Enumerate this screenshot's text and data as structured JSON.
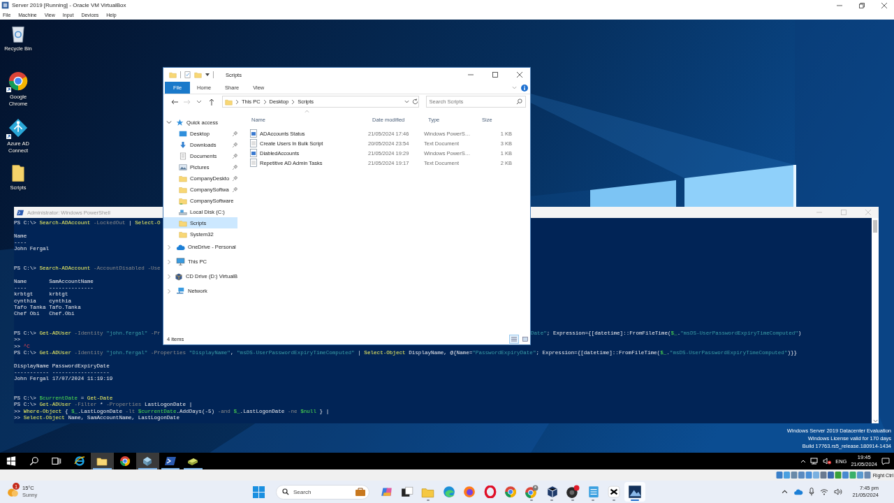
{
  "virtualbox": {
    "title": "Server 2019 [Running] - Oracle VM VirtualBox",
    "menu": [
      "File",
      "Machine",
      "View",
      "Input",
      "Devices",
      "Help"
    ],
    "host_key": "Right Ctrl"
  },
  "desktop_icons": [
    {
      "kind": "recycle-bin",
      "label": "Recycle Bin",
      "shortcut": false
    },
    {
      "kind": "chrome",
      "label": "Google Chrome",
      "shortcut": true
    },
    {
      "kind": "azure",
      "label": "Azure AD Connect",
      "shortcut": true
    },
    {
      "kind": "folder",
      "label": "Scripts",
      "shortcut": false
    }
  ],
  "explorer": {
    "title": "Scripts",
    "ribbon_tabs": [
      {
        "label": "File",
        "selected": true
      },
      {
        "label": "Home",
        "selected": false
      },
      {
        "label": "Share",
        "selected": false
      },
      {
        "label": "View",
        "selected": false
      }
    ],
    "forward_disabled": true,
    "path": [
      "This PC",
      "Desktop",
      "Scripts"
    ],
    "search": {
      "placeholder": "Search Scripts"
    },
    "nav": [
      {
        "kind": "star",
        "label": "Quick access",
        "expanded": true,
        "selected": false,
        "children": [
          {
            "kind": "desktop",
            "label": "Desktop",
            "pinned": true,
            "selected": false
          },
          {
            "kind": "download",
            "label": "Downloads",
            "pinned": true,
            "selected": false
          },
          {
            "kind": "documents",
            "label": "Documents",
            "pinned": true,
            "selected": false
          },
          {
            "kind": "pictures",
            "label": "Pictures",
            "pinned": true,
            "selected": false
          },
          {
            "kind": "folder",
            "label": "CompanyDeskto",
            "pinned": true,
            "selected": false
          },
          {
            "kind": "folder",
            "label": "CompanySoftwa",
            "pinned": true,
            "selected": false
          },
          {
            "kind": "shared-folder",
            "label": "CompanySoftware",
            "pinned": false,
            "selected": false
          },
          {
            "kind": "disk",
            "label": "Local Disk (C:)",
            "pinned": false,
            "selected": false
          },
          {
            "kind": "folder",
            "label": "Scripts",
            "pinned": false,
            "selected": true
          },
          {
            "kind": "folder",
            "label": "System32",
            "pinned": false,
            "selected": false
          }
        ]
      },
      {
        "kind": "cloud",
        "label": "OneDrive - Personal",
        "expanded": false,
        "selected": false
      },
      {
        "kind": "pc",
        "label": "This PC",
        "expanded": false,
        "selected": false
      },
      {
        "kind": "cd",
        "label": "CD Drive (D:) VirtualB",
        "expanded": false,
        "selected": false
      },
      {
        "kind": "network",
        "label": "Network",
        "expanded": false,
        "selected": false
      }
    ],
    "columns": [
      "Name",
      "Date modified",
      "Type",
      "Size"
    ],
    "files": [
      {
        "kind": "script",
        "name": "ADAccounts Status",
        "date": "21/05/2024 17:46",
        "type": "Windows PowerS…",
        "size": "1 KB"
      },
      {
        "kind": "text",
        "name": "Create Users In Bulk Script",
        "date": "20/05/2024 23:54",
        "type": "Text Document",
        "size": "3 KB"
      },
      {
        "kind": "script",
        "name": "DiabledAccounts",
        "date": "21/05/2024 19:29",
        "type": "Windows PowerS…",
        "size": "1 KB"
      },
      {
        "kind": "text",
        "name": "Repetitive AD Admin Tasks",
        "date": "21/05/2024 19:17",
        "type": "Text Document",
        "size": "2 KB"
      }
    ],
    "status": "4 items",
    "view_modes": [
      {
        "kind": "details",
        "selected": true
      },
      {
        "kind": "large-icons",
        "selected": false
      }
    ]
  },
  "powershell": {
    "title": "Administrator: Windows PowerShell",
    "lines": [
      {
        "kind": "text",
        "segments": [
          {
            "kind": "plain",
            "text": "PS C:\\> "
          },
          {
            "kind": "command",
            "text": "Search-ADAccount"
          },
          {
            "kind": "parameter",
            "text": " -LockedOut"
          },
          {
            "kind": "plain",
            "text": " | "
          },
          {
            "kind": "command",
            "text": "Select-O"
          }
        ]
      },
      {
        "kind": "blank"
      },
      {
        "kind": "text",
        "segments": [
          {
            "kind": "plain",
            "text": "Name"
          }
        ]
      },
      {
        "kind": "text",
        "segments": [
          {
            "kind": "plain",
            "text": "----"
          }
        ]
      },
      {
        "kind": "text",
        "segments": [
          {
            "kind": "plain",
            "text": "John Fergal"
          }
        ]
      },
      {
        "kind": "blank"
      },
      {
        "kind": "blank"
      },
      {
        "kind": "text",
        "segments": [
          {
            "kind": "plain",
            "text": "PS C:\\> "
          },
          {
            "kind": "command",
            "text": "Search-ADAccount"
          },
          {
            "kind": "parameter",
            "text": " -AccountDisabled -Use"
          }
        ]
      },
      {
        "kind": "blank"
      },
      {
        "kind": "text",
        "segments": [
          {
            "kind": "plain",
            "text": "Name       SamAccountName"
          }
        ]
      },
      {
        "kind": "text",
        "segments": [
          {
            "kind": "plain",
            "text": "----       --------------"
          }
        ]
      },
      {
        "kind": "text",
        "segments": [
          {
            "kind": "plain",
            "text": "krbtgt     krbtgt"
          }
        ]
      },
      {
        "kind": "text",
        "segments": [
          {
            "kind": "plain",
            "text": "cynthia    cynthia"
          }
        ]
      },
      {
        "kind": "text",
        "segments": [
          {
            "kind": "plain",
            "text": "Tafo Tanka Tafo.Tanka"
          }
        ]
      },
      {
        "kind": "text",
        "segments": [
          {
            "kind": "plain",
            "text": "Chef Obi   Chef.Obi"
          }
        ]
      },
      {
        "kind": "blank"
      },
      {
        "kind": "blank"
      },
      {
        "kind": "split",
        "segments": [
          {
            "kind": "plain",
            "text": "PS C:\\> "
          },
          {
            "kind": "command",
            "text": "Get-ADUser"
          },
          {
            "kind": "parameter",
            "text": " -Identity "
          },
          {
            "kind": "string",
            "text": "\"john.fergal\""
          },
          {
            "kind": "parameter",
            "text": " -Pr"
          }
        ],
        "after_gap": [
          {
            "kind": "string",
            "text": "Date\""
          },
          {
            "kind": "plain",
            "text": "; Expression={[datetime]::FromFileTime("
          },
          {
            "kind": "variable",
            "text": "$_"
          },
          {
            "kind": "plain",
            "text": "."
          },
          {
            "kind": "string",
            "text": "\"msDS-UserPasswordExpiryTimeComputed\""
          },
          {
            "kind": "plain",
            "text": ")"
          }
        ]
      },
      {
        "kind": "text",
        "segments": [
          {
            "kind": "plain",
            "text": ">>"
          }
        ]
      },
      {
        "kind": "text",
        "segments": [
          {
            "kind": "plain",
            "text": ">> "
          },
          {
            "kind": "error",
            "text": "^C"
          }
        ]
      },
      {
        "kind": "text",
        "segments": [
          {
            "kind": "plain",
            "text": "PS C:\\> "
          },
          {
            "kind": "command",
            "text": "Get-ADUser"
          },
          {
            "kind": "parameter",
            "text": " -Identity "
          },
          {
            "kind": "string",
            "text": "\"john.fergal\""
          },
          {
            "kind": "parameter",
            "text": " -Properties "
          },
          {
            "kind": "string",
            "text": "\"DisplayName\""
          },
          {
            "kind": "plain",
            "text": ", "
          },
          {
            "kind": "string",
            "text": "\"msDS-UserPasswordExpiryTimeComputed\""
          },
          {
            "kind": "plain",
            "text": " | "
          },
          {
            "kind": "command",
            "text": "Select-Object"
          },
          {
            "kind": "plain",
            "text": " DisplayName, @{Name="
          },
          {
            "kind": "string",
            "text": "\"PasswordExpiryDate\""
          },
          {
            "kind": "plain",
            "text": "; Expression={[datetime]::FromFileTime("
          },
          {
            "kind": "variable",
            "text": "$_"
          },
          {
            "kind": "plain",
            "text": "."
          },
          {
            "kind": "string",
            "text": "\"msDS-UserPasswordExpiryTimeComputed\""
          },
          {
            "kind": "plain",
            "text": ")}}"
          }
        ]
      },
      {
        "kind": "blank"
      },
      {
        "kind": "text",
        "segments": [
          {
            "kind": "plain",
            "text": "DisplayName PasswordExpiryDate"
          }
        ]
      },
      {
        "kind": "text",
        "segments": [
          {
            "kind": "plain",
            "text": "----------- ------------------"
          }
        ]
      },
      {
        "kind": "text",
        "segments": [
          {
            "kind": "plain",
            "text": "John Fergal 17/07/2024 11:19:19"
          }
        ]
      },
      {
        "kind": "blank"
      },
      {
        "kind": "blank"
      },
      {
        "kind": "text",
        "segments": [
          {
            "kind": "plain",
            "text": "PS C:\\> "
          },
          {
            "kind": "variable",
            "text": "$currentDate"
          },
          {
            "kind": "plain",
            "text": " = "
          },
          {
            "kind": "command",
            "text": "Get-Date"
          }
        ]
      },
      {
        "kind": "text",
        "segments": [
          {
            "kind": "plain",
            "text": "PS C:\\> "
          },
          {
            "kind": "command",
            "text": "Get-ADUser"
          },
          {
            "kind": "parameter",
            "text": " -Filter "
          },
          {
            "kind": "plain",
            "text": "*"
          },
          {
            "kind": "parameter",
            "text": " -Properties "
          },
          {
            "kind": "plain",
            "text": "LastLogonDate |"
          }
        ]
      },
      {
        "kind": "text",
        "segments": [
          {
            "kind": "plain",
            "text": ">> "
          },
          {
            "kind": "command",
            "text": "Where-Object"
          },
          {
            "kind": "plain",
            "text": " { "
          },
          {
            "kind": "variable",
            "text": "$_"
          },
          {
            "kind": "plain",
            "text": ".LastLogonDate "
          },
          {
            "kind": "parameter",
            "text": "-lt "
          },
          {
            "kind": "variable",
            "text": "$currentDate"
          },
          {
            "kind": "plain",
            "text": ".AddDays(-5) "
          },
          {
            "kind": "parameter",
            "text": "-and "
          },
          {
            "kind": "variable",
            "text": "$_"
          },
          {
            "kind": "plain",
            "text": ".LastLogonDate "
          },
          {
            "kind": "parameter",
            "text": "-ne "
          },
          {
            "kind": "variable",
            "text": "$null"
          },
          {
            "kind": "plain",
            "text": " } |"
          }
        ]
      },
      {
        "kind": "text",
        "segments": [
          {
            "kind": "plain",
            "text": ">> "
          },
          {
            "kind": "command",
            "text": "Select-Object"
          },
          {
            "kind": "plain",
            "text": " Name, SamAccountName, LastLogonDate"
          }
        ]
      }
    ]
  },
  "desktop_notice": [
    "Windows Server 2019 Datacenter Evaluation",
    "Windows License valid for 170 days",
    "Build 17763.rs5_release.180914-1434"
  ],
  "guest_taskbar": {
    "apps": [
      {
        "kind": "start",
        "open": false,
        "selected": false
      },
      {
        "kind": "search",
        "open": false,
        "selected": false
      },
      {
        "kind": "task-view",
        "open": false,
        "selected": false
      },
      {
        "kind": "ie",
        "open": false,
        "selected": false
      },
      {
        "kind": "explorer",
        "open": true,
        "selected": true
      },
      {
        "kind": "chrome",
        "open": false,
        "selected": false
      },
      {
        "kind": "server-manager",
        "open": true,
        "selected": true
      },
      {
        "kind": "powershell",
        "open": true,
        "selected": false
      },
      {
        "kind": "tool",
        "open": true,
        "selected": false
      }
    ],
    "language": "ENG",
    "time": "19:45",
    "date": "21/05/2024"
  },
  "host_taskbar": {
    "weather": {
      "badge": "1",
      "temperature": "15°C",
      "condition": "Sunny"
    },
    "search": {
      "placeholder": "Search"
    },
    "apps": [
      {
        "kind": "copilot",
        "open": false,
        "selected": false
      },
      {
        "kind": "task-switch",
        "open": false,
        "selected": false
      },
      {
        "kind": "explorer",
        "open": true,
        "selected": false
      },
      {
        "kind": "edge",
        "open": false,
        "selected": false
      },
      {
        "kind": "firefox",
        "open": false,
        "selected": false
      },
      {
        "kind": "opera",
        "open": false,
        "selected": false
      },
      {
        "kind": "chrome",
        "open": false,
        "selected": false
      },
      {
        "kind": "chrome-profile",
        "open": true,
        "selected": false
      },
      {
        "kind": "virtualbox",
        "open": true,
        "selected": false
      },
      {
        "kind": "recorder",
        "open": true,
        "selected": false
      },
      {
        "kind": "notepad",
        "open": true,
        "selected": false
      },
      {
        "kind": "editor",
        "open": true,
        "selected": false
      },
      {
        "kind": "screen",
        "open": true,
        "selected": true
      }
    ],
    "time": "7:45 pm",
    "date": "21/05/2024"
  }
}
